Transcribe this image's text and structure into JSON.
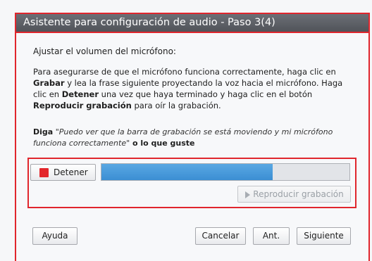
{
  "window": {
    "title": "Asistente para configuración de audio - Paso 3(4)"
  },
  "content": {
    "heading": "Ajustar el volumen del micrófono:",
    "paragraph": {
      "t1": "Para asegurarse de que el micrófono funciona correctamente, haga clic en ",
      "b1": "Grabar",
      "t2": " y lea la frase siguiente proyectando la voz hacia el micrófono. Haga clic en ",
      "b2": "Detener",
      "t3": " una vez que haya terminado y haga clic en el botón ",
      "b3": "Reproducir grabación",
      "t4": " para oír la grabación."
    },
    "instruction": {
      "lead": "Diga",
      "quote": "\"Puedo ver que la barra de grabación se está moviendo y mi micrófono funciona correctamente\"",
      "tail": " o lo que guste"
    }
  },
  "recorder": {
    "stop_label": "Detener",
    "stop_icon": "stop-icon",
    "progress": 0.69,
    "play_label": "Reproducir grabación",
    "play_icon": "play-icon",
    "colors": {
      "stop": "#e3262b",
      "progress": "#4a9ad9",
      "highlight": "#e0262d"
    }
  },
  "footer": {
    "help_label": "Ayuda",
    "cancel_label": "Cancelar",
    "back_label": "Ant.",
    "next_label": "Siguiente"
  }
}
